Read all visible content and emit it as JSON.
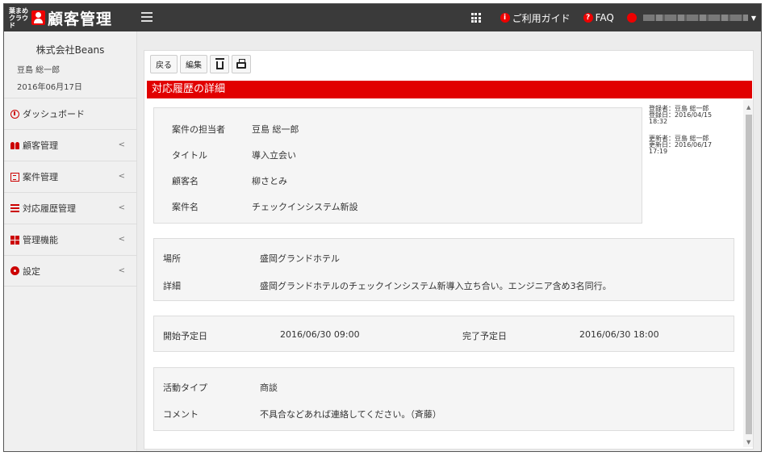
{
  "header": {
    "logo_small": "葉まめクラウド",
    "app_title": "顧客管理",
    "guide_label": "ご利用ガイド",
    "faq_label": "FAQ"
  },
  "sidebar": {
    "company": "株式会社Beans",
    "user_name": "豆島 総一郎",
    "date": "2016年06月17日",
    "items": [
      {
        "label": "ダッシュボード",
        "icon": "dashboard-icon"
      },
      {
        "label": "顧客管理",
        "icon": "users-icon"
      },
      {
        "label": "案件管理",
        "icon": "case-icon"
      },
      {
        "label": "対応履歴管理",
        "icon": "list-icon"
      },
      {
        "label": "管理機能",
        "icon": "grid-icon"
      },
      {
        "label": "設定",
        "icon": "gear-icon"
      }
    ]
  },
  "toolbar": {
    "back_label": "戻る",
    "edit_label": "編集"
  },
  "page": {
    "title": "対応履歴の詳細"
  },
  "detail": {
    "staff_label": "案件の担当者",
    "staff_value": "豆島 総一郎",
    "title_label": "タイトル",
    "title_value": "導入立会い",
    "customer_label": "顧客名",
    "customer_value": "柳さとみ",
    "case_label": "案件名",
    "case_value": "チェックインシステム新設"
  },
  "meta": {
    "created_by": "登録者：豆島 総一郎",
    "created_at": "登録日：2016/04/15",
    "created_time": "18:32",
    "updated_by": "更新者：豆島 総一郎",
    "updated_at": "更新日：2016/06/17",
    "updated_time": "17:19"
  },
  "location": {
    "place_label": "場所",
    "place_value": "盛岡グランドホテル",
    "detail_label": "詳細",
    "detail_value": "盛岡グランドホテルのチェックインシステム新導入立ち合い。エンジニア含め3名同行。"
  },
  "schedule": {
    "start_label": "開始予定日",
    "start_value": "2016/06/30 09:00",
    "end_label": "完了予定日",
    "end_value": "2016/06/30 18:00"
  },
  "activity": {
    "type_label": "活動タイプ",
    "type_value": "商談",
    "comment_label": "コメント",
    "comment_value": "不具合などあれば連絡してください。（斉藤）"
  },
  "colors": {
    "accent": "#e10000",
    "topbar": "#3a3a3a"
  }
}
